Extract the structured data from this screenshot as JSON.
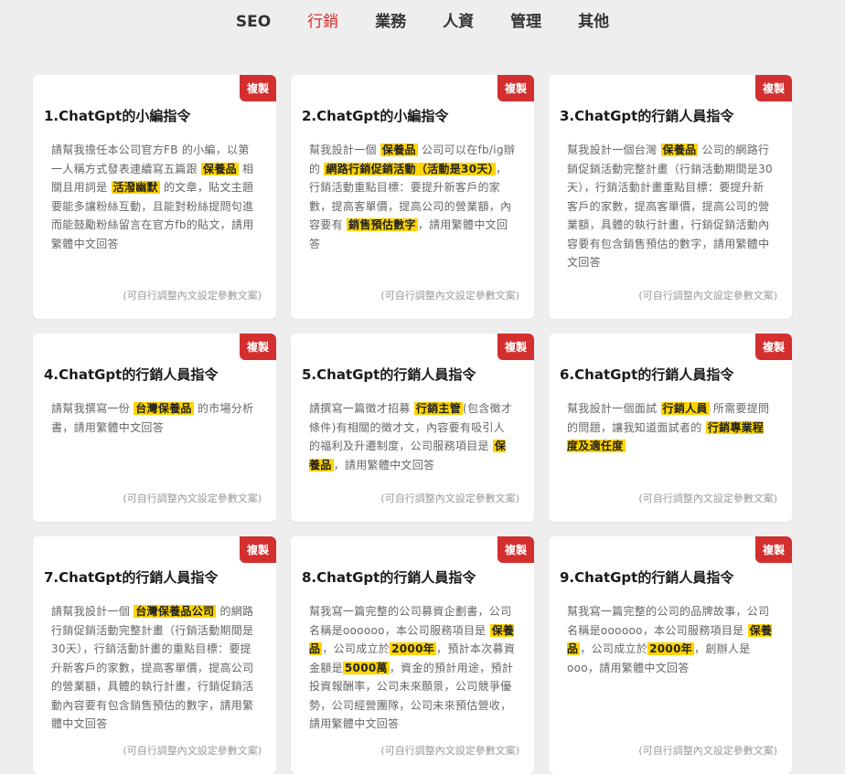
{
  "tabs": [
    {
      "label": "SEO",
      "active": false
    },
    {
      "label": "行銷",
      "active": true
    },
    {
      "label": "業務",
      "active": false
    },
    {
      "label": "人資",
      "active": false
    },
    {
      "label": "管理",
      "active": false
    },
    {
      "label": "其他",
      "active": false
    }
  ],
  "accent_color": "#d32f2f",
  "highlight_color": "#ffd400",
  "cards": [
    {
      "title": "1.ChatGpt的小編指令",
      "copy_label": "複製",
      "footer": "(可自行調整內文設定參數文案)",
      "body": [
        {
          "t": "請幫我擔任本公司官方FB 的小編，以第一人稱方式發表連續寫五篇跟 "
        },
        {
          "t": "保養品",
          "hl": true
        },
        {
          "t": " 相關且用詞是 "
        },
        {
          "t": "活潑幽默",
          "hl": true
        },
        {
          "t": " 的文章，貼文主題要能多讓粉絲互動，且能對粉絲提問句進而能鼓勵粉絲留言在官方fb的貼文，請用繁體中文回答"
        }
      ]
    },
    {
      "title": "2.ChatGpt的小編指令",
      "copy_label": "複製",
      "footer": "(可自行調整內文設定參數文案)",
      "body": [
        {
          "t": "幫我設計一個 "
        },
        {
          "t": "保養品",
          "hl": true
        },
        {
          "t": " 公司可以在fb/ig辦的 "
        },
        {
          "t": "網路行銷促銷活動（活動是30天）",
          "hl": true
        },
        {
          "t": "，行銷活動重點目標：要提升新客戶的家數，提高客單價，提高公司的營業額，內容要有 "
        },
        {
          "t": "銷售預估數字",
          "hl": true
        },
        {
          "t": "，請用繁體中文回答"
        }
      ]
    },
    {
      "title": "3.ChatGpt的行銷人員指令",
      "copy_label": "複製",
      "footer": "(可自行調整內文設定參數文案)",
      "body": [
        {
          "t": "幫我設計一個台灣 "
        },
        {
          "t": "保養品",
          "hl": true
        },
        {
          "t": " 公司的網路行銷促銷活動完整計畫（行銷活動期間是30天），行銷活動計畫重點目標：要提升新客戶的家數，提高客單價，提高公司的營業額，具體的執行計畫，行銷促銷活動內容要有包含銷售預估的數字，請用繁體中文回答"
        }
      ]
    },
    {
      "title": "4.ChatGpt的行銷人員指令",
      "copy_label": "複製",
      "footer": "(可自行調整內文設定參數文案)",
      "body": [
        {
          "t": "請幫我撰寫一份 "
        },
        {
          "t": "台灣保養品",
          "hl": true
        },
        {
          "t": " 的市場分析書，請用繁體中文回答"
        }
      ]
    },
    {
      "title": "5.ChatGpt的行銷人員指令",
      "copy_label": "複製",
      "footer": "(可自行調整內文設定參數文案)",
      "body": [
        {
          "t": "請撰寫一篇徵才招募 "
        },
        {
          "t": "行銷主管",
          "hl": true
        },
        {
          "t": "(包含徵才條件)有相關的徵才文，內容要有吸引人的福利及升遷制度，公司服務項目是 "
        },
        {
          "t": "保養品",
          "hl": true
        },
        {
          "t": "，請用繁體中文回答"
        }
      ]
    },
    {
      "title": "6.ChatGpt的行銷人員指令",
      "copy_label": "複製",
      "footer": "(可自行調整內文設定參數文案)",
      "body": [
        {
          "t": "幫我設計一個面試 "
        },
        {
          "t": "行銷人員",
          "hl": true
        },
        {
          "t": " 所需要提問的問題，讓我知道面試者的 "
        },
        {
          "t": "行銷專業程度及適任度",
          "hl": true
        }
      ]
    },
    {
      "title": "7.ChatGpt的行銷人員指令",
      "copy_label": "複製",
      "footer": "(可自行調整內文設定參數文案)",
      "body": [
        {
          "t": "請幫我設計一個 "
        },
        {
          "t": "台灣保養品公司",
          "hl": true
        },
        {
          "t": " 的網路行銷促銷活動完整計畫（行銷活動期間是30天），行銷活動計畫的重點目標：要提升新客戶的家數，提高客單價，提高公司的營業額，具體的執行計畫，行銷促銷活動內容要有包含銷售預估的數字，請用繁體中文回答"
        }
      ]
    },
    {
      "title": "8.ChatGpt的行銷人員指令",
      "copy_label": "複製",
      "footer": "(可自行調整內文設定參數文案)",
      "body": [
        {
          "t": "幫我寫一篇完整的公司募資企劃書，公司名稱是oooooo，本公司服務項目是 "
        },
        {
          "t": "保養品",
          "hl": true
        },
        {
          "t": "，公司成立於"
        },
        {
          "t": "2000年",
          "hl": true
        },
        {
          "t": "，預計本次募資金額是"
        },
        {
          "t": "5000萬",
          "hl": true
        },
        {
          "t": "，資金的預計用途，預計投資報酬率，公司未來願景，公司競爭優勢，公司經營團隊，公司未來預估營收，請用繁體中文回答"
        }
      ]
    },
    {
      "title": "9.ChatGpt的行銷人員指令",
      "copy_label": "複製",
      "footer": "(可自行調整內文設定參數文案)",
      "body": [
        {
          "t": "幫我寫一篇完整的公司的品牌故事，公司名稱是oooooo，本公司服務項目是 "
        },
        {
          "t": "保養品",
          "hl": true
        },
        {
          "t": "，公司成立於"
        },
        {
          "t": "2000年",
          "hl": true
        },
        {
          "t": "，創辦人是ooo，請用繁體中文回答"
        }
      ]
    }
  ]
}
